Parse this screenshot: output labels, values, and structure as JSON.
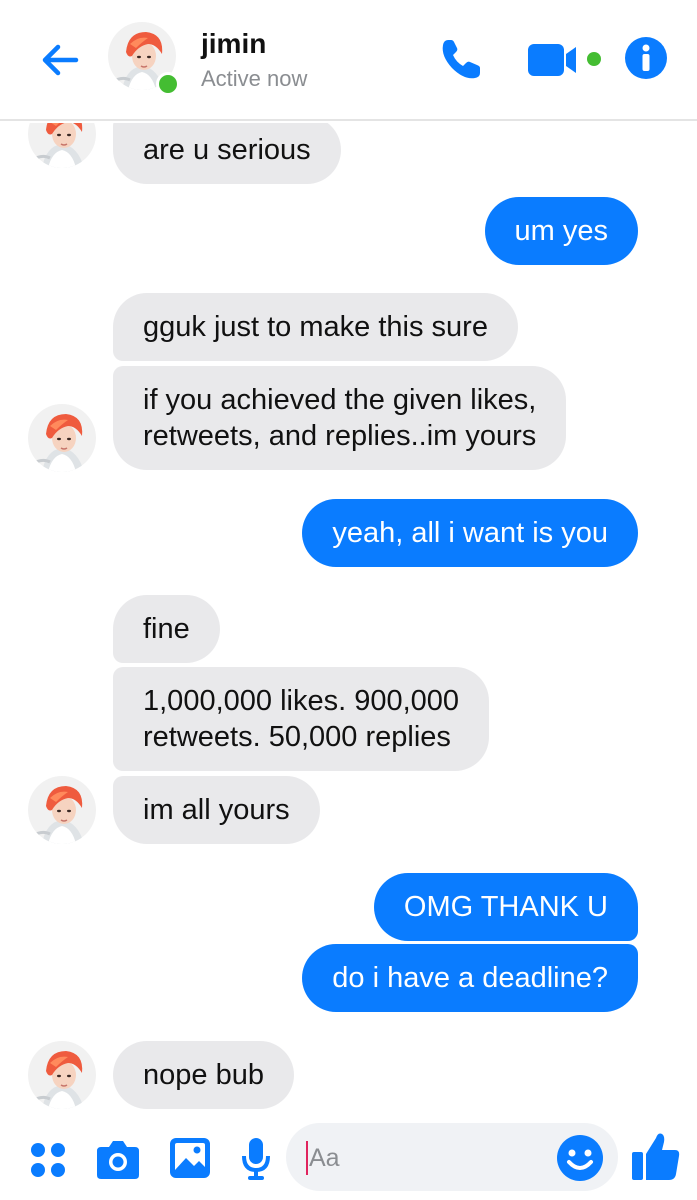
{
  "header": {
    "contact_name": "jimin",
    "status": "Active now",
    "icons": [
      "back-arrow-icon",
      "phone-icon",
      "video-camera-icon",
      "info-icon"
    ],
    "accent_color": "#0a7cff",
    "presence_color": "#44bd32"
  },
  "messages": [
    {
      "from": "them",
      "text": "are u serious"
    },
    {
      "from": "me",
      "text": "um yes"
    },
    {
      "from": "them",
      "text": "gguk just to make this sure"
    },
    {
      "from": "them",
      "text": "if you achieved the given likes,\nretweets, and replies..im yours"
    },
    {
      "from": "me",
      "text": "yeah, all i want is you"
    },
    {
      "from": "them",
      "text": "fine"
    },
    {
      "from": "them",
      "text": "1,000,000 likes. 900,000\nretweets. 50,000 replies"
    },
    {
      "from": "them",
      "text": "im all yours"
    },
    {
      "from": "me",
      "text": "OMG THANK U"
    },
    {
      "from": "me",
      "text": "do i have a deadline?"
    },
    {
      "from": "them",
      "text": "nope bub"
    }
  ],
  "composer": {
    "placeholder": "Aa",
    "icons": [
      "menu-dots-icon",
      "camera-icon",
      "gallery-icon",
      "microphone-icon",
      "emoji-icon",
      "thumbs-up-icon"
    ]
  },
  "colors": {
    "incoming_bubble": "#e9e9eb",
    "outgoing_bubble": "#0a7cff"
  }
}
